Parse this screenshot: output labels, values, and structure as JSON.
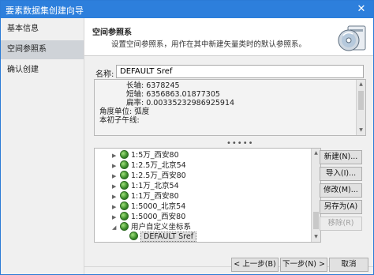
{
  "window": {
    "title": "要素数据集创建向导",
    "close_glyph": "✕"
  },
  "sidebar": {
    "items": [
      {
        "label": "基本信息",
        "active": false
      },
      {
        "label": "空间参照系",
        "active": true
      },
      {
        "label": "确认创建",
        "active": false
      }
    ]
  },
  "header": {
    "title": "空间参照系",
    "description": "设置空间参照系，用作在其中新建矢量类时的默认参照系。",
    "icon": "cd-disc-icon"
  },
  "name_field": {
    "label": "名称:",
    "value": "DEFAULT Sref"
  },
  "info": {
    "rows": [
      "长轴:    6378245",
      "短轴:    6356863.01877305",
      "扁率:    0.00335232986925914",
      "角度单位:  弧度",
      "本初子午线:"
    ]
  },
  "splitter": {
    "glyph": "•••••"
  },
  "tree": {
    "items": [
      {
        "label": "1:5万_西安80",
        "expanded": false
      },
      {
        "label": "1:2.5万_北京54",
        "expanded": false
      },
      {
        "label": "1:2.5万_西安80",
        "expanded": false
      },
      {
        "label": "1:1万_北京54",
        "expanded": false
      },
      {
        "label": "1:1万_西安80",
        "expanded": false
      },
      {
        "label": "1:5000_北京54",
        "expanded": false
      },
      {
        "label": "1:5000_西安80",
        "expanded": false
      },
      {
        "label": "用户自定义坐标系",
        "expanded": true
      },
      {
        "label": "DEFAULT Sref",
        "selected": true
      }
    ]
  },
  "actions": {
    "new": "新建(N)...",
    "import": "导入(I)...",
    "modify": "修改(M)...",
    "save_as": "另存为(A)",
    "remove": "移除(R)"
  },
  "footer": {
    "prev": "上一步(B)",
    "next": "下一步(N)",
    "cancel": "取消"
  },
  "colors": {
    "titlebar": "#2d7fdc",
    "accent": "#2b7bd6"
  }
}
